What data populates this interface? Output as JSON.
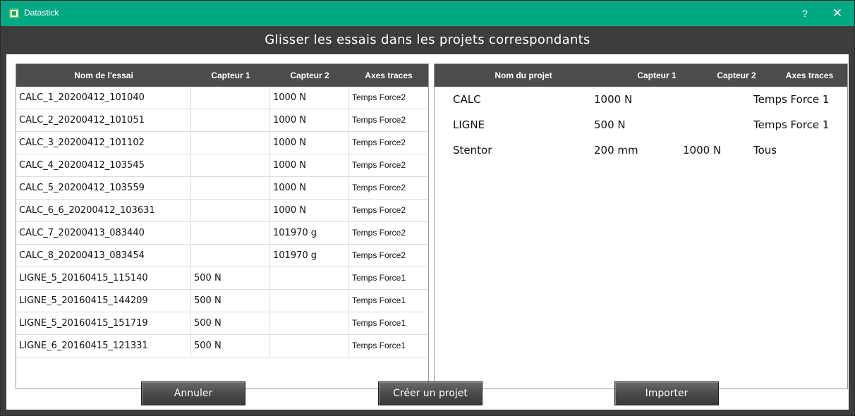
{
  "window": {
    "title": "Datastick",
    "help_label": "?",
    "close_label": "✕",
    "titlebar_color": "#00a884"
  },
  "banner": "Glisser les essais dans les projets correspondants",
  "left_table": {
    "headers": [
      "Nom de l'essai",
      "Capteur 1",
      "Capteur 2",
      "Axes traces"
    ],
    "rows": [
      [
        "CALC_1_20200412_101040",
        "",
        "1000 N",
        "Temps Force2"
      ],
      [
        "CALC_2_20200412_101051",
        "",
        "1000 N",
        "Temps Force2"
      ],
      [
        "CALC_3_20200412_101102",
        "",
        "1000 N",
        "Temps Force2"
      ],
      [
        "CALC_4_20200412_103545",
        "",
        "1000 N",
        "Temps Force2"
      ],
      [
        "CALC_5_20200412_103559",
        "",
        "1000 N",
        "Temps Force2"
      ],
      [
        "CALC_6_6_20200412_103631",
        "",
        "1000 N",
        "Temps Force2"
      ],
      [
        "CALC_7_20200413_083440",
        "",
        "101970 g",
        "Temps Force2"
      ],
      [
        "CALC_8_20200413_083454",
        "",
        "101970 g",
        "Temps Force2"
      ],
      [
        "LIGNE_5_20160415_115140",
        "500 N",
        "",
        "Temps Force1"
      ],
      [
        "LIGNE_5_20160415_144209",
        "500 N",
        "",
        "Temps Force1"
      ],
      [
        "LIGNE_5_20160415_151719",
        "500 N",
        "",
        "Temps Force1"
      ],
      [
        "LIGNE_6_20160415_121331",
        "500 N",
        "",
        "Temps Force1"
      ]
    ]
  },
  "right_table": {
    "headers": [
      "Nom du projet",
      "Capteur 1",
      "Capteur 2",
      "Axes traces"
    ],
    "rows": [
      [
        "CALC",
        "1000 N",
        "",
        "Temps Force 1"
      ],
      [
        "LIGNE",
        "500 N",
        "",
        "Temps Force 1"
      ],
      [
        "Stentor",
        "200 mm",
        "1000 N",
        "Tous"
      ]
    ]
  },
  "buttons": {
    "cancel": "Annuler",
    "create": "Créer un projet",
    "import": "Importer"
  }
}
